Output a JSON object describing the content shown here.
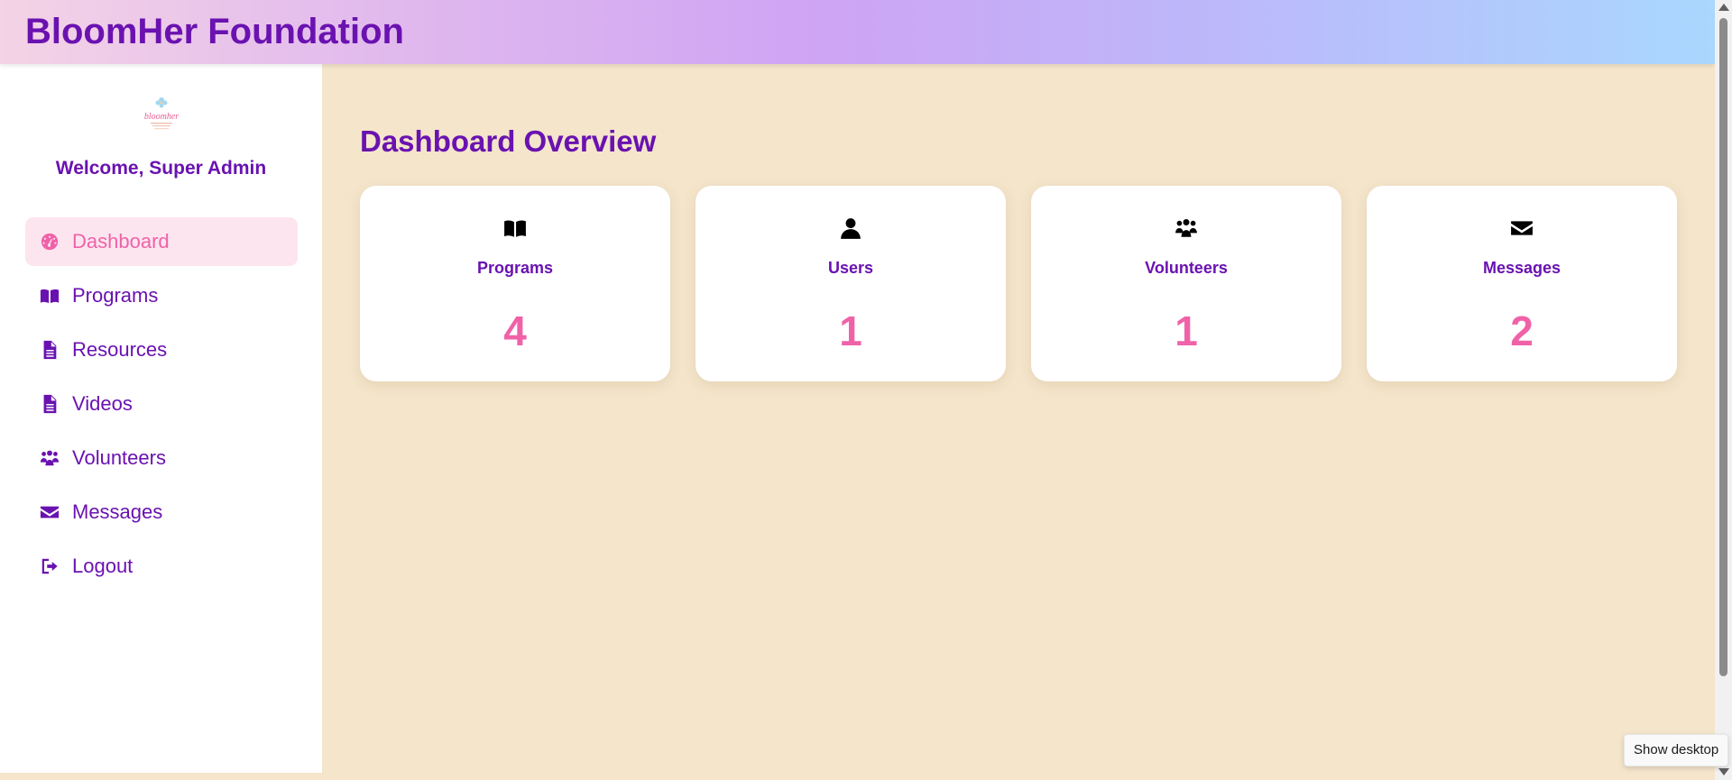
{
  "header": {
    "title": "BloomHer Foundation"
  },
  "sidebar": {
    "logo_text": "bloomher",
    "welcome": "Welcome, Super Admin",
    "items": [
      {
        "label": "Dashboard",
        "icon": "tachometer-icon",
        "active": true
      },
      {
        "label": "Programs",
        "icon": "book-open-icon"
      },
      {
        "label": "Resources",
        "icon": "file-icon"
      },
      {
        "label": "Videos",
        "icon": "file-icon"
      },
      {
        "label": "Volunteers",
        "icon": "users-icon"
      },
      {
        "label": "Messages",
        "icon": "envelope-icon"
      },
      {
        "label": "Logout",
        "icon": "sign-out-icon"
      }
    ]
  },
  "main": {
    "title": "Dashboard Overview",
    "cards": [
      {
        "label": "Programs",
        "value": "4",
        "icon": "book-open-icon"
      },
      {
        "label": "Users",
        "value": "1",
        "icon": "user-icon"
      },
      {
        "label": "Volunteers",
        "value": "1",
        "icon": "users-icon"
      },
      {
        "label": "Messages",
        "value": "2",
        "icon": "envelope-icon"
      }
    ]
  },
  "tooltip": {
    "text": "Show desktop"
  },
  "colors": {
    "accent": "#6a12b0",
    "pink": "#f062a8",
    "background": "#f4e5cb",
    "active_bg": "#fde5ef"
  }
}
